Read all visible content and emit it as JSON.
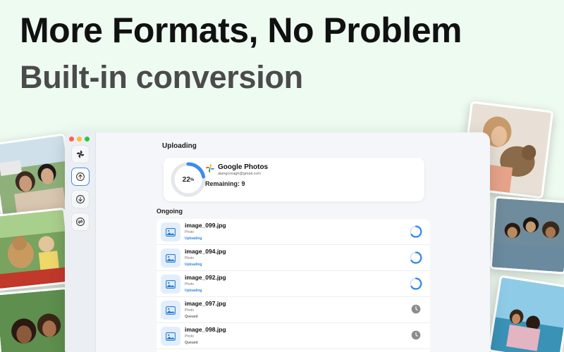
{
  "headline": "More Formats, No Problem",
  "subheadline": "Built-in conversion",
  "colors": {
    "accent": "#3a8cf0",
    "background": "#eefbf1"
  },
  "sidebar": {
    "items": [
      {
        "icon": "pinwheel-icon",
        "active": false
      },
      {
        "icon": "upload-arrow-icon",
        "active": true
      },
      {
        "icon": "download-arrow-icon",
        "active": false
      },
      {
        "icon": "sync-icon",
        "active": false
      }
    ]
  },
  "uploading": {
    "title": "Uploading",
    "progress_label": "22",
    "progress_unit": "%",
    "progress_value": 0.22,
    "service": "Google Photos",
    "email": "alangcreagh@gmail.com",
    "remaining": "Remaining: 9"
  },
  "ongoing": {
    "title": "Ongoing",
    "items": [
      {
        "name": "image_099.jpg",
        "type": "Photo",
        "status": "Uploading"
      },
      {
        "name": "image_094.jpg",
        "type": "Photo",
        "status": "Uploading"
      },
      {
        "name": "image_092.jpg",
        "type": "Photo",
        "status": "Uploading"
      },
      {
        "name": "image_097.jpg",
        "type": "Photo",
        "status": "Queued"
      },
      {
        "name": "image_098.jpg",
        "type": "Photo",
        "status": "Queued"
      }
    ]
  }
}
